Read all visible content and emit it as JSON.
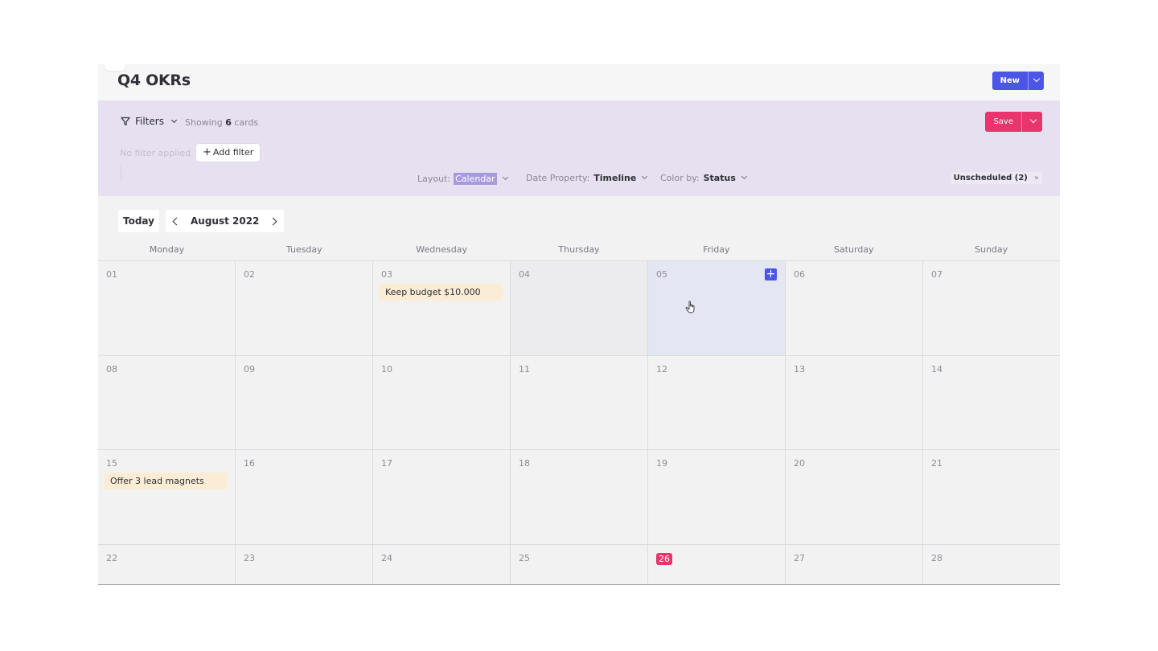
{
  "header": {
    "title": "Q4 OKRs",
    "new_label": "New"
  },
  "filters": {
    "filters_label": "Filters",
    "showing_prefix": "Showing",
    "showing_count": "6",
    "showing_suffix": "cards",
    "no_filter": "No filter applied.",
    "add_filter": "Add filter",
    "save_label": "Save"
  },
  "view_options": {
    "layout_label": "Layout:",
    "layout_value": "Calendar",
    "date_label": "Date Property:",
    "date_value": "Timeline",
    "color_label": "Color by:",
    "color_value": "Status",
    "unscheduled": "Unscheduled (2)"
  },
  "calendar": {
    "today_label": "Today",
    "month": "August 2022",
    "weekdays": [
      "Monday",
      "Tuesday",
      "Wednesday",
      "Thursday",
      "Friday",
      "Saturday",
      "Sunday"
    ],
    "weeks": [
      [
        "01",
        "02",
        "03",
        "04",
        "05",
        "06",
        "07"
      ],
      [
        "08",
        "09",
        "10",
        "11",
        "12",
        "13",
        "14"
      ],
      [
        "15",
        "16",
        "17",
        "18",
        "19",
        "20",
        "21"
      ],
      [
        "22",
        "23",
        "24",
        "25",
        "26",
        "27",
        "28"
      ]
    ],
    "cards": {
      "aug03": "Keep budget $10.000",
      "aug15": "Offer 3 lead magnets"
    }
  },
  "colors": {
    "accent_blue": "#4b55e6",
    "accent_pink": "#e8356d",
    "filter_bg": "#e7e0f0",
    "card_bg": "#fbedd5"
  }
}
